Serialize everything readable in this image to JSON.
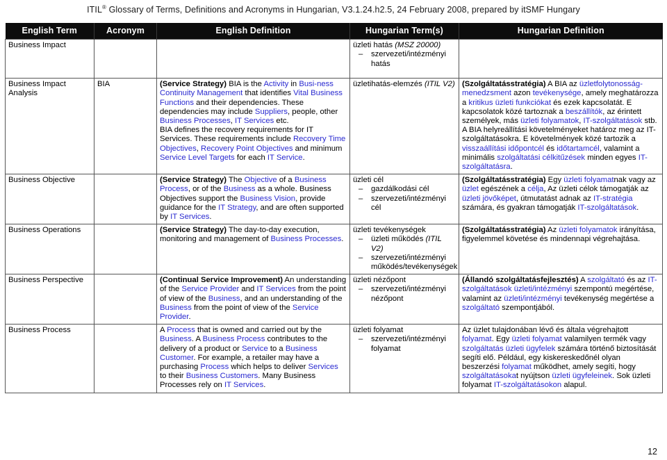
{
  "document": {
    "header_line": "ITIL® Glossary of Terms, Definitions and Acronyms in Hungarian, V3.1.24.h2.5, 24 February 2008, prepared by itSMF Hungary",
    "header_parts": {
      "pre": "ITIL",
      "sup": "®",
      "post": " Glossary of Terms, Definitions and Acronyms in Hungarian, V3.1.24.h2.5, 24 February 2008, prepared by itSMF Hungary"
    },
    "page_number": "12"
  },
  "colors": {
    "link_blue": "#2a2ad0",
    "header_bg": "#0d0d0d",
    "header_fg": "#ffffff",
    "border": "#555555",
    "text": "#000000"
  },
  "table": {
    "columns": [
      "English Term",
      "Acronym",
      "English Definition",
      "Hungarian Term(s)",
      "Hungarian Definition"
    ],
    "rows": [
      {
        "english_term": "Business Impact",
        "acronym": "",
        "english_definition": "",
        "hungarian_term_main": "üzleti hatás (MSZ 20000)",
        "hungarian_term_main_plain": "üzleti hatás ",
        "hungarian_term_main_ital": "(MSZ 20000)",
        "hungarian_term_sub": [
          "szervezeti/intézményi hatás"
        ],
        "hungarian_definition": ""
      },
      {
        "english_term": "Business Impact Analysis",
        "acronym": "BIA",
        "english_definition": "(Service Strategy) BIA is the Activity in Business Continuity Management that identifies Vital Business Functions and their dependencies. These dependencies may include Suppliers, people, other Business Processes, IT Services etc.\nBIA defines the recovery requirements for IT Services. These requirements include Recovery Time Objectives, Recovery Point Objectives and minimum Service Level Targets for each IT Service.",
        "hungarian_term_main_plain": "üzletihatás-elemzés ",
        "hungarian_term_main_ital": "(ITIL V2)",
        "hungarian_term_sub": [],
        "hungarian_definition": "(Szolgáltatásstratégia) A BIA az üzletfolytonosság-menedzsment azon tevékenysége, amely meghatározza a kritikus üzleti funkciókat és ezek kapcsolatát. E kapcsolatok közé tartoznak a beszállítók, az érintett személyek, más üzleti folyamatok, IT-szolgáltatások stb.\nA BIA helyreállítási követelményeket határoz meg az IT-szolgáltatásokra. E követelmények közé tartozik a visszaállítási időpontcél és időtartamcél, valamint a minimális szolgáltatási célkitűzések minden egyes IT-szolgáltatásra."
      },
      {
        "english_term": "Business Objective",
        "acronym": "",
        "english_definition": "(Service Strategy) The Objective of a Business Process, or of the Business as a whole. Business Objectives support the Business Vision, provide guidance for the IT Strategy, and are often supported by IT Services.",
        "hungarian_term_main_plain": "üzleti cél",
        "hungarian_term_main_ital": "",
        "hungarian_term_sub": [
          "gazdálkodási cél",
          "szervezeti/intézményi cél"
        ],
        "hungarian_definition": "(Szolgáltatásstratégia) Egy üzleti folyamatnak vagy az üzlet egészének a célja, Az üzleti célok támogatják az üzleti jövőképet, útmutatást adnak az IT-stratégia számára, és gyakran támogatják IT-szolgáltatások."
      },
      {
        "english_term": "Business Operations",
        "acronym": "",
        "english_definition": "(Service Strategy) The day-to-day execution, monitoring and management of Business Processes.",
        "hungarian_term_main_plain": "üzleti tevékenységek",
        "hungarian_term_main_ital": "",
        "hungarian_term_sub": [
          "üzleti működés (ITIL V2)",
          "szervezeti/intézményi működés/tevékenységek"
        ],
        "hungarian_definition": "(Szolgáltatásstratégia) Az üzleti folyamatok irányítása, figyelemmel követése és mindennapi végrehajtása."
      },
      {
        "english_term": "Business Perspective",
        "acronym": "",
        "english_definition": "(Continual Service Improvement) An understanding of the Service Provider and IT Services from the point of view of the Business, and an understanding of the Business from the point of view of the Service Provider.",
        "hungarian_term_main_plain": "üzleti nézőpont",
        "hungarian_term_main_ital": "",
        "hungarian_term_sub": [
          "szervezeti/intézményi nézőpont"
        ],
        "hungarian_definition": "(Állandó szolgáltatásfejlesztés) A szolgáltató és az IT-szolgáltatások üzleti/intézményi szempontú megértése, valamint az üzleti/intézményi tevékenység megértése a szolgáltató szempontjából."
      },
      {
        "english_term": "Business Process",
        "acronym": "",
        "english_definition": "A Process that is owned and carried out by the Business. A Business Process contributes to the delivery of a product or Service to a Business Customer. For example, a retailer may have a purchasing Process which helps to deliver Services to their Business Customers. Many Business Processes rely on IT Services.",
        "hungarian_term_main_plain": "üzleti folyamat",
        "hungarian_term_main_ital": "",
        "hungarian_term_sub": [
          "szervezeti/intézményi folyamat"
        ],
        "hungarian_definition": "Az üzlet tulajdonában lévő és általa végrehajtott folyamat. Egy üzleti folyamat valamilyen termék vagy szolgáltatás üzleti ügyfelek számára történő biztosítását segíti elő. Például, egy kiskereskedőnél olyan beszerzési folyamat működhet, amely segíti, hogy szolgáltatásokat nyújtson üzleti ügyfeleinek. Sok üzleti folyamat IT-szolgáltatásokon alapul."
      }
    ]
  },
  "rich_text": {
    "row1_hu_term_main": [
      {
        "t": "üzleti hatás ",
        "s": "plain"
      },
      {
        "t": "(MSZ 20000)",
        "s": "ital"
      }
    ],
    "row1_hu_term_sub": [
      [
        {
          "t": "szervezeti/intézményi hatás",
          "s": "plain"
        }
      ]
    ],
    "row2_en_def": [
      {
        "t": "(Service Strategy)",
        "s": "bold"
      },
      {
        "t": " BIA is the ",
        "s": "plain"
      },
      {
        "t": "Activity",
        "s": "blue"
      },
      {
        "t": " in ",
        "s": "plain"
      },
      {
        "t": "Busi-​ness Continuity Management",
        "s": "blue"
      },
      {
        "t": " that identifies ",
        "s": "plain"
      },
      {
        "t": "Vital Business Functions",
        "s": "blue"
      },
      {
        "t": " and their dependencies. These dependencies may include ",
        "s": "plain"
      },
      {
        "t": "Suppliers",
        "s": "blue"
      },
      {
        "t": ", people, other ",
        "s": "plain"
      },
      {
        "t": "Business Processes",
        "s": "blue"
      },
      {
        "t": ", ",
        "s": "plain"
      },
      {
        "t": "IT Services",
        "s": "blue"
      },
      {
        "t": " etc.",
        "s": "plain"
      },
      {
        "t": "\n",
        "s": "br"
      },
      {
        "t": "BIA defines the recovery requirements for IT Services. These requirements include ",
        "s": "plain"
      },
      {
        "t": "Recovery Time Objectives",
        "s": "blue"
      },
      {
        "t": ", ",
        "s": "plain"
      },
      {
        "t": "Recovery Point Objectives",
        "s": "blue"
      },
      {
        "t": " and minimum ",
        "s": "plain"
      },
      {
        "t": "Service Level Targets",
        "s": "blue"
      },
      {
        "t": " for each ",
        "s": "plain"
      },
      {
        "t": "IT Service",
        "s": "blue"
      },
      {
        "t": ".",
        "s": "plain"
      }
    ],
    "row2_hu_term_main": [
      {
        "t": "üzletihatás-elemzés ",
        "s": "plain"
      },
      {
        "t": "(ITIL V2)",
        "s": "ital"
      }
    ],
    "row2_hu_def": [
      {
        "t": "(Szolgáltatásstratégia)",
        "s": "bold"
      },
      {
        "t": " A BIA az ",
        "s": "plain"
      },
      {
        "t": "üzletfolytonosság-menedzsment",
        "s": "blue"
      },
      {
        "t": " azon ",
        "s": "plain"
      },
      {
        "t": "tevékenysége",
        "s": "blue"
      },
      {
        "t": ", amely meghatározza a ",
        "s": "plain"
      },
      {
        "t": "kritikus üzleti funkciókat",
        "s": "blue"
      },
      {
        "t": " és ezek kapcsolatát. E kapcsolatok közé tartoznak a ",
        "s": "plain"
      },
      {
        "t": "beszállítók",
        "s": "blue"
      },
      {
        "t": ", az érintett személyek, más ",
        "s": "plain"
      },
      {
        "t": "üzleti folyamatok",
        "s": "blue"
      },
      {
        "t": ", ",
        "s": "plain"
      },
      {
        "t": "IT-szolgáltatások",
        "s": "blue"
      },
      {
        "t": " stb.",
        "s": "plain"
      },
      {
        "t": "\n",
        "s": "br"
      },
      {
        "t": "A BIA helyreállítási követelményeket határoz meg az IT-szolgáltatásokra. E követelmények közé tartozik a ",
        "s": "plain"
      },
      {
        "t": "visszaállítási időpontcél",
        "s": "blue"
      },
      {
        "t": " és ",
        "s": "plain"
      },
      {
        "t": "időtartamcél",
        "s": "blue"
      },
      {
        "t": ", valamint a minimális ",
        "s": "plain"
      },
      {
        "t": "szolgáltatási célkitűzések",
        "s": "blue"
      },
      {
        "t": " minden egyes ",
        "s": "plain"
      },
      {
        "t": "IT-szolgáltatásra",
        "s": "blue"
      },
      {
        "t": ".",
        "s": "plain"
      }
    ],
    "row3_en_def": [
      {
        "t": "(Service Strategy)",
        "s": "bold"
      },
      {
        "t": " The ",
        "s": "plain"
      },
      {
        "t": "Objective",
        "s": "blue"
      },
      {
        "t": " of a ",
        "s": "plain"
      },
      {
        "t": "Business Process",
        "s": "blue"
      },
      {
        "t": ", or of the ",
        "s": "plain"
      },
      {
        "t": "Business",
        "s": "blue"
      },
      {
        "t": " as a whole. Business Objectives support the ",
        "s": "plain"
      },
      {
        "t": "Business Vision",
        "s": "blue"
      },
      {
        "t": ", provide guidance for the ",
        "s": "plain"
      },
      {
        "t": "IT Strategy",
        "s": "blue"
      },
      {
        "t": ", and are often supported by ",
        "s": "plain"
      },
      {
        "t": "IT Services",
        "s": "blue"
      },
      {
        "t": ".",
        "s": "plain"
      }
    ],
    "row3_hu_term_main": [
      {
        "t": "üzleti cél",
        "s": "plain"
      }
    ],
    "row3_hu_term_sub": [
      [
        {
          "t": "gazdálkodási cél",
          "s": "plain"
        }
      ],
      [
        {
          "t": "szervezeti/intézményi cél",
          "s": "plain"
        }
      ]
    ],
    "row3_hu_def": [
      {
        "t": "(Szolgáltatásstratégia)",
        "s": "bold"
      },
      {
        "t": " Egy ",
        "s": "plain"
      },
      {
        "t": "üzleti folyamat",
        "s": "blue"
      },
      {
        "t": "nak vagy az ",
        "s": "plain"
      },
      {
        "t": "üzlet",
        "s": "blue"
      },
      {
        "t": " egészének a ",
        "s": "plain"
      },
      {
        "t": "célja",
        "s": "blue"
      },
      {
        "t": ", Az üzleti célok támogatják az ",
        "s": "plain"
      },
      {
        "t": "üzleti jövőképet",
        "s": "blue"
      },
      {
        "t": ", útmutatást adnak az ",
        "s": "plain"
      },
      {
        "t": "IT-stratégia",
        "s": "blue"
      },
      {
        "t": " számára, és gyakran támogatják ",
        "s": "plain"
      },
      {
        "t": "IT-szolgáltatások",
        "s": "blue"
      },
      {
        "t": ".",
        "s": "plain"
      }
    ],
    "row4_en_def": [
      {
        "t": "(Service Strategy)",
        "s": "bold"
      },
      {
        "t": " The day-to-day execution, monitoring and management of ",
        "s": "plain"
      },
      {
        "t": "Business Processes",
        "s": "blue"
      },
      {
        "t": ".",
        "s": "plain"
      }
    ],
    "row4_hu_term_main": [
      {
        "t": "üzleti tevékenységek",
        "s": "plain"
      }
    ],
    "row4_hu_term_sub": [
      [
        {
          "t": "üzleti működés ",
          "s": "plain"
        },
        {
          "t": "(ITIL V2)",
          "s": "ital"
        }
      ],
      [
        {
          "t": "szervezeti/intézményi működés/tevékenységek",
          "s": "plain"
        }
      ]
    ],
    "row4_hu_def": [
      {
        "t": "(Szolgáltatásstratégia)",
        "s": "bold"
      },
      {
        "t": " Az ",
        "s": "plain"
      },
      {
        "t": "üzleti folyamatok",
        "s": "blue"
      },
      {
        "t": " irányítása, figyelemmel követése és mindennapi végrehajtása.",
        "s": "plain"
      }
    ],
    "row5_en_def": [
      {
        "t": "(Continual Service Improvement)",
        "s": "bold"
      },
      {
        "t": " An understanding of the ",
        "s": "plain"
      },
      {
        "t": "Service Provider",
        "s": "blue"
      },
      {
        "t": " and ",
        "s": "plain"
      },
      {
        "t": "IT Services",
        "s": "blue"
      },
      {
        "t": " from the point of view of the ",
        "s": "plain"
      },
      {
        "t": "Business",
        "s": "blue"
      },
      {
        "t": ", and an understanding of the ",
        "s": "plain"
      },
      {
        "t": "Business",
        "s": "blue"
      },
      {
        "t": " from the point of view of the ",
        "s": "plain"
      },
      {
        "t": "Service Provider",
        "s": "blue"
      },
      {
        "t": ".",
        "s": "plain"
      }
    ],
    "row5_hu_term_main": [
      {
        "t": "üzleti nézőpont",
        "s": "plain"
      }
    ],
    "row5_hu_term_sub": [
      [
        {
          "t": "szervezeti/intézményi nézőpont",
          "s": "plain"
        }
      ]
    ],
    "row5_hu_def": [
      {
        "t": "(Állandó szolgáltatásfejlesztés)",
        "s": "bold"
      },
      {
        "t": " A ",
        "s": "plain"
      },
      {
        "t": "szolgáltató",
        "s": "blue"
      },
      {
        "t": " és az ",
        "s": "plain"
      },
      {
        "t": "IT-szolgáltatások",
        "s": "blue"
      },
      {
        "t": " ",
        "s": "plain"
      },
      {
        "t": "üzleti/intézményi",
        "s": "blue"
      },
      {
        "t": " szempontú megértése, valamint az ",
        "s": "plain"
      },
      {
        "t": "üzleti/intézményi",
        "s": "blue"
      },
      {
        "t": " tevékenység megértése a ",
        "s": "plain"
      },
      {
        "t": "szolgáltató",
        "s": "blue"
      },
      {
        "t": " szempontjából.",
        "s": "plain"
      }
    ],
    "row6_en_def": [
      {
        "t": "A ",
        "s": "plain"
      },
      {
        "t": "Process",
        "s": "blue"
      },
      {
        "t": " that is owned and carried out by the ",
        "s": "plain"
      },
      {
        "t": "Business",
        "s": "blue"
      },
      {
        "t": ". A ",
        "s": "plain"
      },
      {
        "t": "Business Process",
        "s": "blue"
      },
      {
        "t": " contributes to the delivery of a product or ",
        "s": "plain"
      },
      {
        "t": "Service",
        "s": "blue"
      },
      {
        "t": " to a ",
        "s": "plain"
      },
      {
        "t": "Business Customer",
        "s": "blue"
      },
      {
        "t": ". For example, a retailer may have a purchasing ",
        "s": "plain"
      },
      {
        "t": "Process",
        "s": "blue"
      },
      {
        "t": " which helps to deliver ",
        "s": "plain"
      },
      {
        "t": "Services",
        "s": "blue"
      },
      {
        "t": " to their ",
        "s": "plain"
      },
      {
        "t": "Business Customers",
        "s": "blue"
      },
      {
        "t": ". Many Business Processes rely on ",
        "s": "plain"
      },
      {
        "t": "IT Services",
        "s": "blue"
      },
      {
        "t": ".",
        "s": "plain"
      }
    ],
    "row6_hu_term_main": [
      {
        "t": "üzleti folyamat",
        "s": "plain"
      }
    ],
    "row6_hu_term_sub": [
      [
        {
          "t": "szervezeti/intézményi folyamat",
          "s": "plain"
        }
      ]
    ],
    "row6_hu_def": [
      {
        "t": "Az üzlet tulajdonában lévő és általa végrehajtott ",
        "s": "plain"
      },
      {
        "t": "folyamat",
        "s": "blue"
      },
      {
        "t": ". Egy ",
        "s": "plain"
      },
      {
        "t": "üzleti folyamat",
        "s": "blue"
      },
      {
        "t": " valamilyen termék vagy ",
        "s": "plain"
      },
      {
        "t": "szolgáltatás üzleti ügyfelek",
        "s": "blue"
      },
      {
        "t": " számára történő biztosítását segíti elő. Például, egy kiskereskedőnél olyan beszerzési ",
        "s": "plain"
      },
      {
        "t": "folyamat",
        "s": "blue"
      },
      {
        "t": " működhet, amely segíti, hogy ",
        "s": "plain"
      },
      {
        "t": "szolgáltatásoka",
        "s": "blue"
      },
      {
        "t": "t nyújtson ",
        "s": "plain"
      },
      {
        "t": "üzleti ügyfeleinek",
        "s": "blue"
      },
      {
        "t": ". Sok üzleti folyamat ",
        "s": "plain"
      },
      {
        "t": "IT-szolgáltatásokon",
        "s": "blue"
      },
      {
        "t": " alapul.",
        "s": "plain"
      }
    ]
  }
}
